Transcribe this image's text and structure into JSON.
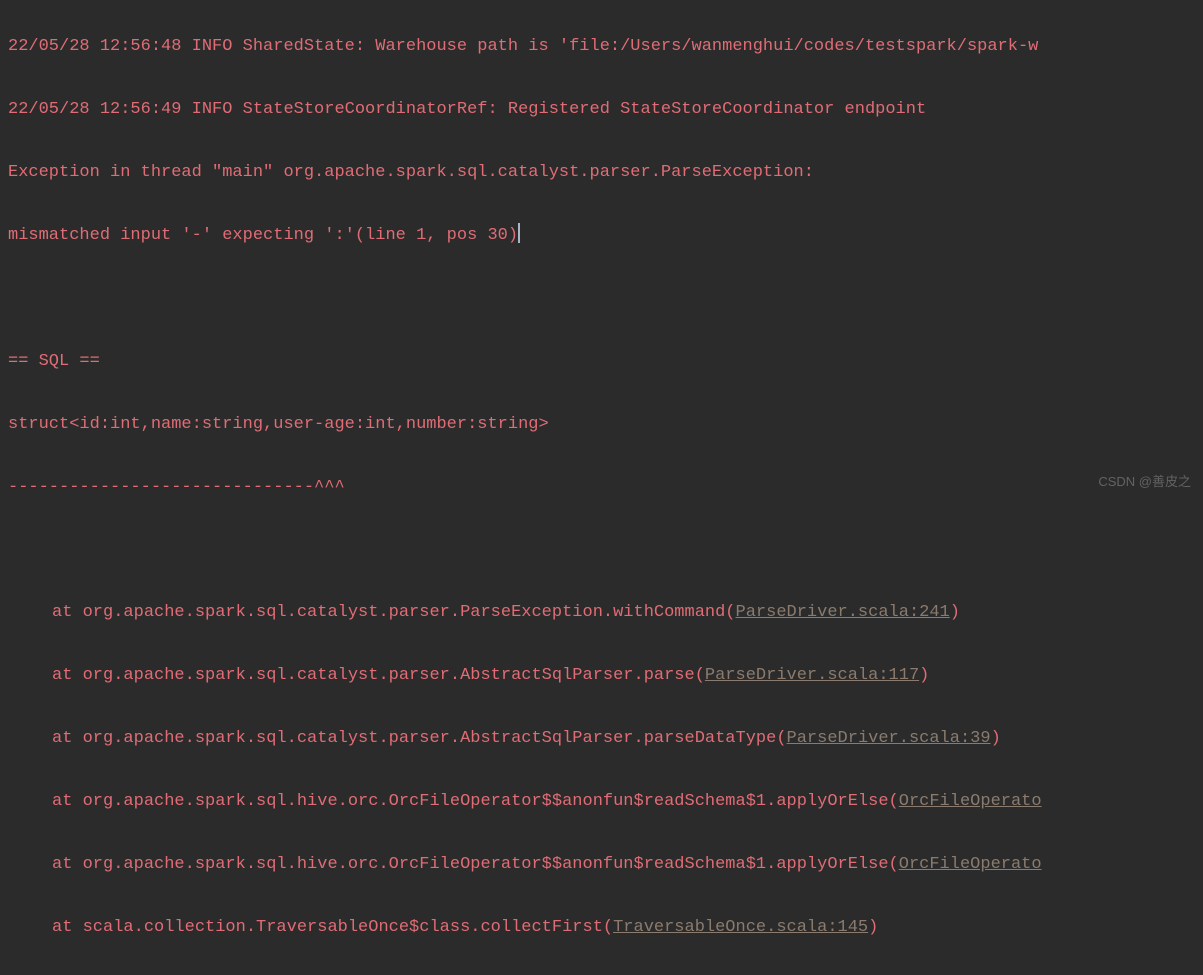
{
  "log": {
    "line1": "22/05/28 12:56:48 INFO SharedState: Warehouse path is 'file:/Users/wanmenghui/codes/testspark/spark-w",
    "line2": "22/05/28 12:56:49 INFO StateStoreCoordinatorRef: Registered StateStoreCoordinator endpoint",
    "line3": "Exception in thread \"main\" org.apache.spark.sql.catalyst.parser.ParseException:",
    "line4": "mismatched input '-' expecting ':'(line 1, pos 30)",
    "sql_header": "== SQL ==",
    "sql_struct": "struct<id:int,name:string,user-age:int,number:string>",
    "sql_marker": "------------------------------^^^"
  },
  "stack": [
    {
      "prefix": "at org.apache.spark.sql.catalyst.parser.ParseException.withCommand(",
      "link": "ParseDriver.scala:241",
      "suffix": ")"
    },
    {
      "prefix": "at org.apache.spark.sql.catalyst.parser.AbstractSqlParser.parse(",
      "link": "ParseDriver.scala:117",
      "suffix": ")"
    },
    {
      "prefix": "at org.apache.spark.sql.catalyst.parser.AbstractSqlParser.parseDataType(",
      "link": "ParseDriver.scala:39",
      "suffix": ")"
    },
    {
      "prefix": "at org.apache.spark.sql.hive.orc.OrcFileOperator$$anonfun$readSchema$1.applyOrElse(",
      "link": "OrcFileOperato",
      "suffix": ""
    },
    {
      "prefix": "at org.apache.spark.sql.hive.orc.OrcFileOperator$$anonfun$readSchema$1.applyOrElse(",
      "link": "OrcFileOperato",
      "suffix": ""
    },
    {
      "prefix": "at scala.collection.TraversableOnce$class.collectFirst(",
      "link": "TraversableOnce.scala:145",
      "suffix": ")"
    }
  ],
  "watermark": "CSDN @善皮之"
}
